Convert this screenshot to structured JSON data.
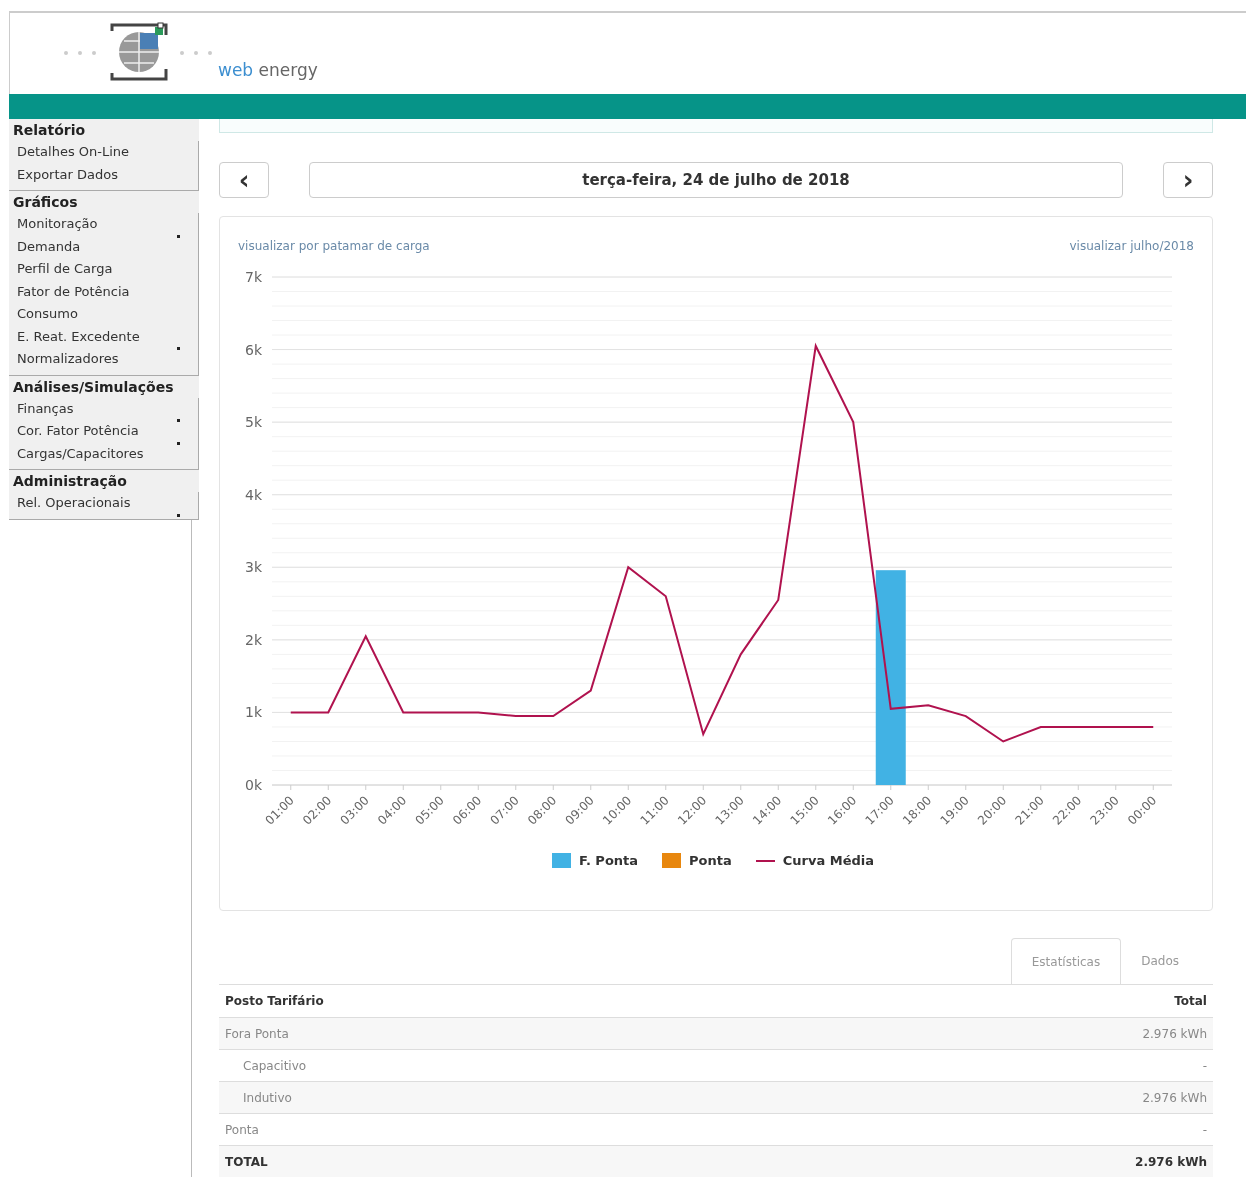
{
  "logo": {
    "word_1": "web",
    "word_2": "energy"
  },
  "sidebar": [
    {
      "title": "Relatório",
      "items": [
        {
          "label": "Detalhes On-Line",
          "submenu": false
        },
        {
          "label": "Exportar Dados",
          "submenu": false
        }
      ]
    },
    {
      "title": "Gráficos",
      "items": [
        {
          "label": "Monitoração",
          "submenu": true
        },
        {
          "label": "Demanda",
          "submenu": false
        },
        {
          "label": "Perfil de Carga",
          "submenu": false
        },
        {
          "label": "Fator de Potência",
          "submenu": false
        },
        {
          "label": "Consumo",
          "submenu": false
        },
        {
          "label": "E. Reat. Excedente",
          "submenu": true
        },
        {
          "label": "Normalizadores",
          "submenu": false
        }
      ]
    },
    {
      "title": "Análises/Simulações",
      "items": [
        {
          "label": "Finanças",
          "submenu": true
        },
        {
          "label": "Cor. Fator Potência",
          "submenu": true
        },
        {
          "label": "Cargas/Capacitores",
          "submenu": false
        }
      ]
    },
    {
      "title": "Administração",
      "items": [
        {
          "label": "Rel. Operacionais",
          "submenu": true
        }
      ]
    }
  ],
  "date_nav": {
    "prev": "‹",
    "date": "terça-feira, 24 de julho de 2018",
    "next": "›"
  },
  "chart_links": [
    "visualizar por patamar de carga",
    "visualizar julho/2018"
  ],
  "chart_data": {
    "type": "bar",
    "categories": [
      "01:00",
      "02:00",
      "03:00",
      "04:00",
      "05:00",
      "06:00",
      "07:00",
      "08:00",
      "09:00",
      "10:00",
      "11:00",
      "12:00",
      "13:00",
      "14:00",
      "15:00",
      "16:00",
      "17:00",
      "18:00",
      "19:00",
      "20:00",
      "21:00",
      "22:00",
      "23:00",
      "00:00"
    ],
    "ylim": [
      0,
      7000
    ],
    "grid": true,
    "legend": "bottom",
    "yticks": [
      {
        "value": 0,
        "label": "0k"
      },
      {
        "value": 1000,
        "label": "1k"
      },
      {
        "value": 2000,
        "label": "2k"
      },
      {
        "value": 3000,
        "label": "3k"
      },
      {
        "value": 4000,
        "label": "4k"
      },
      {
        "value": 5000,
        "label": "5k"
      },
      {
        "value": 6000,
        "label": "6k"
      },
      {
        "value": 7000,
        "label": "7k"
      }
    ],
    "series": [
      {
        "name": "F. Ponta",
        "color": "#41b2e4",
        "type": "bar",
        "values": [
          null,
          null,
          null,
          null,
          null,
          null,
          null,
          null,
          null,
          null,
          null,
          null,
          null,
          null,
          null,
          null,
          2960,
          null,
          null,
          null,
          null,
          null,
          null,
          null
        ]
      },
      {
        "name": "Ponta",
        "color": "#e8870e",
        "type": "bar",
        "values": [
          null,
          null,
          null,
          null,
          null,
          null,
          null,
          null,
          null,
          null,
          null,
          null,
          null,
          null,
          null,
          null,
          null,
          null,
          null,
          null,
          null,
          null,
          null,
          null
        ]
      },
      {
        "name": "Curva Média",
        "color": "#b0124e",
        "type": "line",
        "values": [
          1000,
          1000,
          2050,
          1000,
          1000,
          1000,
          950,
          950,
          1300,
          3000,
          2600,
          700,
          1800,
          2550,
          6050,
          5000,
          1050,
          1100,
          950,
          600,
          800,
          800,
          800,
          800
        ]
      }
    ]
  },
  "tabs": [
    {
      "label": "Estatísticas",
      "selected": true
    },
    {
      "label": "Dados",
      "selected": false
    }
  ],
  "table": {
    "columns": [
      "Posto Tarifário",
      "Total"
    ],
    "rows": [
      {
        "label": "Fora Ponta",
        "total": "2.976 kWh",
        "children": [
          {
            "label": "Capacitivo",
            "total": "-"
          },
          {
            "label": "Indutivo",
            "total": "2.976 kWh"
          }
        ]
      },
      {
        "label": "Ponta",
        "total": "-"
      }
    ],
    "footer": {
      "label": "TOTAL",
      "total": "2.976 kWh"
    }
  }
}
